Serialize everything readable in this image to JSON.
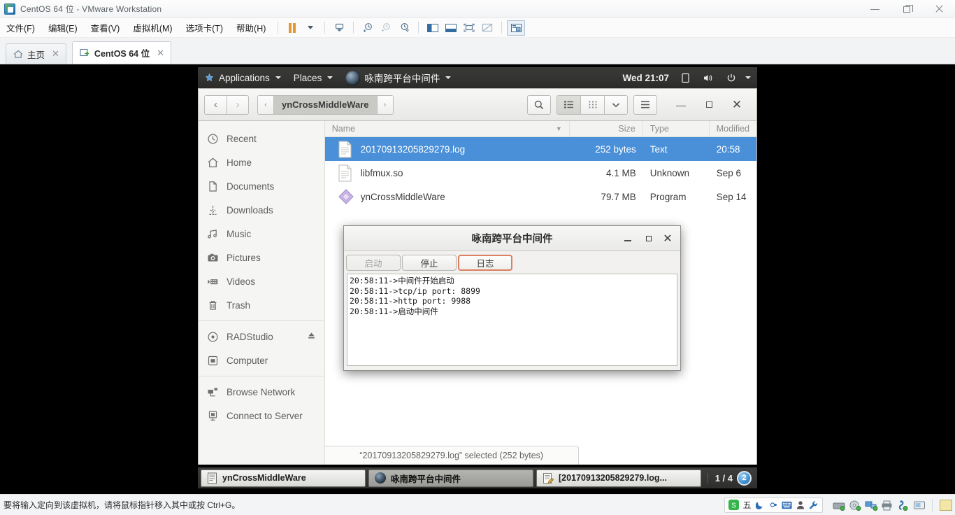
{
  "vmware": {
    "window_title": "CentOS 64 位 - VMware Workstation",
    "app_icon": "vmware-logo-icon",
    "window_controls": {
      "minimize": "minimize-icon",
      "restore": "restore-icon",
      "close": "close-icon"
    },
    "menus": [
      {
        "label": "文件(F)",
        "name": "menu-file"
      },
      {
        "label": "编辑(E)",
        "name": "menu-edit"
      },
      {
        "label": "查看(V)",
        "name": "menu-view"
      },
      {
        "label": "虚拟机(M)",
        "name": "menu-vm"
      },
      {
        "label": "选项卡(T)",
        "name": "menu-tabs"
      },
      {
        "label": "帮助(H)",
        "name": "menu-help"
      }
    ],
    "toolbar": [
      {
        "name": "suspend-button",
        "icon": "pause-icon"
      },
      {
        "name": "power-dropdown",
        "icon": "chevron-down-icon"
      },
      {
        "name": "snapshot-manage-button",
        "icon": "snapshot-icon"
      },
      {
        "name": "take-snapshot-button",
        "icon": "snapshot-add-icon"
      },
      {
        "name": "revert-snapshot-button",
        "icon": "snapshot-revert-icon"
      },
      {
        "name": "snapshot-manager-button",
        "icon": "snapshot-settings-icon"
      },
      {
        "name": "show-library-button",
        "icon": "library-panel-icon"
      },
      {
        "name": "show-thumbnail-bar-button",
        "icon": "thumbnail-bar-icon"
      },
      {
        "name": "fullscreen-button",
        "icon": "fullscreen-icon"
      },
      {
        "name": "unity-mode-button",
        "icon": "unity-icon"
      },
      {
        "name": "console-view-button",
        "icon": "console-view-icon"
      }
    ],
    "tabs": [
      {
        "label": "主页",
        "icon": "home-icon",
        "active": false
      },
      {
        "label": "CentOS 64 位",
        "icon": "vm-icon",
        "active": true
      }
    ],
    "tab_close_icon": "close-icon",
    "status_text": "要将输入定向到该虚拟机，请将鼠标指针移入其中或按 Ctrl+G。",
    "ime": {
      "items": [
        "sogou-logo-icon",
        "五",
        "moon-icon",
        "半角-icon",
        "keyboard-icon",
        "user-icon",
        "wrench-icon"
      ],
      "mode_label": "五"
    },
    "devices": [
      {
        "name": "hard-disk-device-icon"
      },
      {
        "name": "cd-dvd-device-icon"
      },
      {
        "name": "network-adapter-device-icon"
      },
      {
        "name": "printer-device-icon"
      },
      {
        "name": "usb-device-icon"
      },
      {
        "name": "display-device-icon"
      }
    ],
    "note_icon": "sticky-note-icon"
  },
  "gnome_panel": {
    "applications_label": "Applications",
    "places_label": "Places",
    "active_app_label": "咏南跨平台中间件",
    "active_app_icon": "app-globe-icon",
    "clock": "Wed 21:07",
    "tray": [
      {
        "name": "notification-icon",
        "glyph": "notebook"
      },
      {
        "name": "volume-icon",
        "glyph": "speaker"
      },
      {
        "name": "power-icon",
        "glyph": "power"
      },
      {
        "name": "system-menu-caret-icon",
        "glyph": "caret"
      }
    ]
  },
  "nautilus": {
    "nav": {
      "back": "back-icon",
      "forward": "forward-icon"
    },
    "breadcrumb": {
      "left_arrow": "chevron-left-icon",
      "current": "ynCrossMiddleWare",
      "right_arrow": "chevron-right-icon"
    },
    "toolbar": {
      "search": "search-icon",
      "list_view": "list-view-icon",
      "grid_view": "grid-view-icon",
      "view_options": "chevron-down-icon",
      "menu": "hamburger-menu-icon"
    },
    "window_controls": {
      "minimize": "minimize-icon",
      "maximize": "maximize-icon",
      "close": "close-icon"
    },
    "sidebar": [
      {
        "label": "Recent",
        "icon": "clock-icon",
        "group": 0
      },
      {
        "label": "Home",
        "icon": "home-icon",
        "group": 0
      },
      {
        "label": "Documents",
        "icon": "document-icon",
        "group": 0
      },
      {
        "label": "Downloads",
        "icon": "download-icon",
        "group": 0
      },
      {
        "label": "Music",
        "icon": "music-note-icon",
        "group": 0
      },
      {
        "label": "Pictures",
        "icon": "camera-icon",
        "group": 0
      },
      {
        "label": "Videos",
        "icon": "video-icon",
        "group": 0
      },
      {
        "label": "Trash",
        "icon": "trash-icon",
        "group": 0
      },
      {
        "label": "RADStudio",
        "icon": "disc-icon",
        "group": 1,
        "eject": "eject-icon"
      },
      {
        "label": "Computer",
        "icon": "computer-icon",
        "group": 1
      },
      {
        "label": "Browse Network",
        "icon": "network-icon",
        "group": 2
      },
      {
        "label": "Connect to Server",
        "icon": "server-connect-icon",
        "group": 2
      }
    ],
    "columns": {
      "name": "Name",
      "size": "Size",
      "type": "Type",
      "modified": "Modified",
      "sort_icon": "sort-descending-icon"
    },
    "files": [
      {
        "name": "20170913205829279.log",
        "size": "252 bytes",
        "type": "Text",
        "modified": "20:58",
        "icon": "text-file-icon",
        "selected": true
      },
      {
        "name": "libfmux.so",
        "size": "4.1 MB",
        "type": "Unknown",
        "modified": "Sep 6",
        "icon": "text-file-icon",
        "selected": false
      },
      {
        "name": "ynCrossMiddleWare",
        "size": "79.7 MB",
        "type": "Program",
        "modified": "Sep 14",
        "icon": "program-icon",
        "selected": false
      }
    ],
    "status": "“20170913205829279.log” selected (252 bytes)"
  },
  "dialog": {
    "title": "咏南跨平台中间件",
    "window_controls": {
      "minimize": "minimize-icon",
      "maximize": "maximize-icon",
      "close": "close-icon"
    },
    "tabs": [
      {
        "label": "启动",
        "state": "disabled"
      },
      {
        "label": "停止",
        "state": "normal"
      },
      {
        "label": "日志",
        "state": "active"
      }
    ],
    "log_lines": [
      "20:58:11->中间件开始启动",
      "20:58:11->tcp/ip port: 8899",
      "20:58:11->http port: 9988",
      "20:58:11->启动中间件"
    ]
  },
  "taskbar": {
    "windows": [
      {
        "label": "ynCrossMiddleWare",
        "icon": "terminal-window-icon",
        "focused": false
      },
      {
        "label": "咏南跨平台中间件",
        "icon": "app-globe-icon",
        "focused": true
      },
      {
        "label": "[20170913205829279.log...",
        "icon": "text-editor-icon",
        "focused": false
      }
    ],
    "pager_label": "1 / 4",
    "workspace_badge": "2"
  },
  "colors": {
    "selection_blue": "#4a90d9",
    "panel_dark": "#2e2e2c",
    "accent_orange": "#d98060",
    "vm_pause_orange": "#e8962e"
  }
}
